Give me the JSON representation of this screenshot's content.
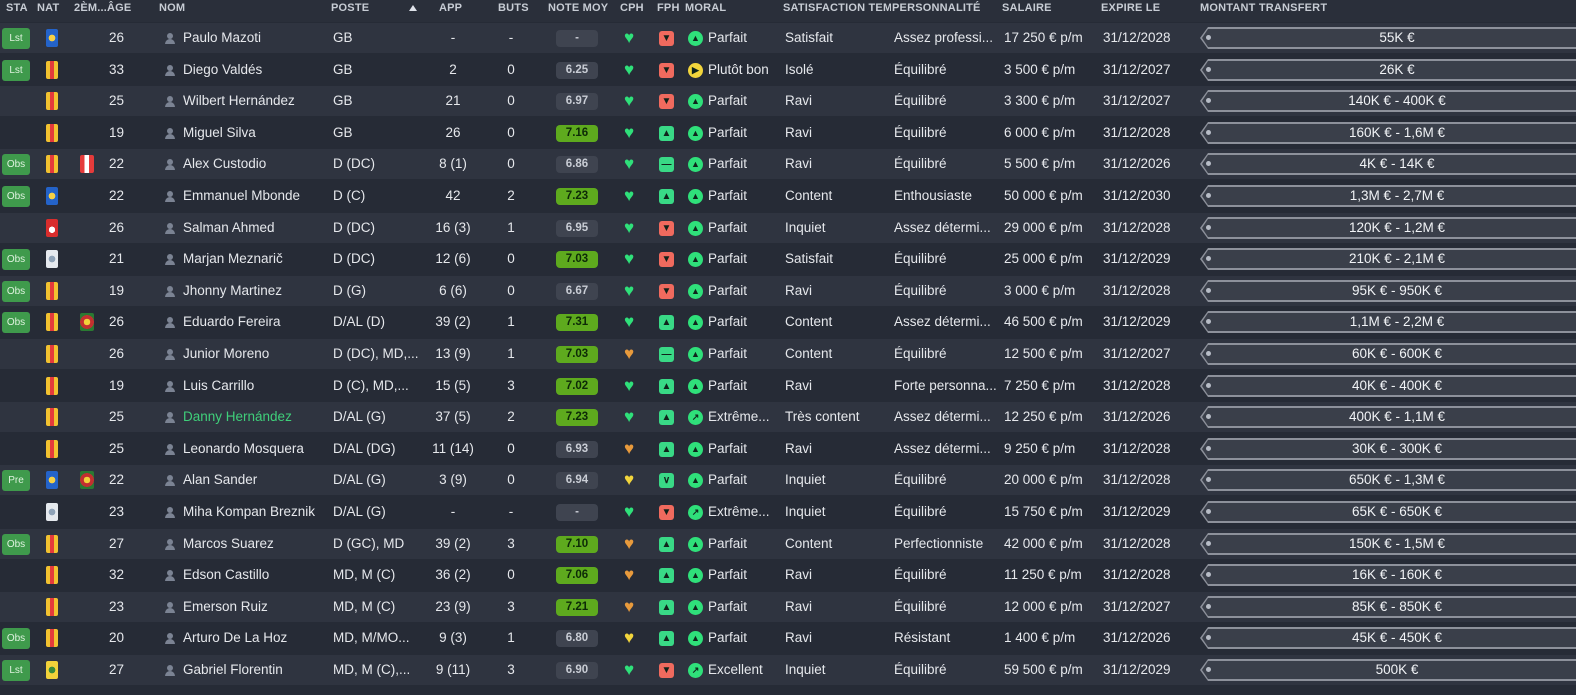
{
  "headers": {
    "sta": "STA",
    "nat": "NAT",
    "nat2": "2ÈM...",
    "age": "ÂGE",
    "nom": "NOM",
    "poste": "POSTE",
    "app": "APP",
    "buts": "BUTS",
    "note": "NOTE MOY",
    "cph": "CPH",
    "fph": "FPH",
    "moral": "MORAL",
    "satisfaction": "SATISFACTION TEM...",
    "personnalite": "PERSONNALITÉ",
    "salaire": "SALAIRE",
    "expire": "EXPIRE LE",
    "transfert": "MONTANT TRANSFERT"
  },
  "colors": {
    "header_bg": "#2a2f3a",
    "row_odd": "#2f3440",
    "row_even": "#262b36",
    "badge_green": "#3f9a4c",
    "note_green": "#5eaa1e",
    "heart_green": "#2fe07a",
    "heart_orange": "#e89a3c",
    "fph_green": "#39d986",
    "fph_red": "#f06a5e",
    "fph_yellow": "#f2d53c",
    "highlight_name": "#3fcf7a"
  },
  "players": [
    {
      "sta": "Lst",
      "nat": "blue",
      "nat2": "",
      "age": "26",
      "nom": "Paulo Mazoti",
      "poste": "GB",
      "app": "-",
      "buts": "-",
      "note": "-",
      "note_level": "grey",
      "cph": "green",
      "fph": "red",
      "moral": "Parfait",
      "moral_icon": "up",
      "satisfaction": "Satisfait",
      "personnalite": "Assez professi...",
      "salaire": "17 250 € p/m",
      "expire": "31/12/2028",
      "transfert": "55K €"
    },
    {
      "sta": "Lst",
      "nat": "col",
      "nat2": "",
      "age": "33",
      "nom": "Diego Valdés",
      "poste": "GB",
      "app": "2",
      "buts": "0",
      "note": "6.25",
      "note_level": "grey",
      "cph": "green",
      "fph": "red",
      "moral": "Plutôt bon",
      "moral_icon": "right-yellow",
      "satisfaction": "Isolé",
      "personnalite": "Équilibré",
      "salaire": "3 500 € p/m",
      "expire": "31/12/2027",
      "transfert": "26K €"
    },
    {
      "sta": "",
      "nat": "col",
      "nat2": "",
      "age": "25",
      "nom": "Wilbert Hernández",
      "poste": "GB",
      "app": "21",
      "buts": "0",
      "note": "6.97",
      "note_level": "grey",
      "cph": "green",
      "fph": "red",
      "moral": "Parfait",
      "moral_icon": "up",
      "satisfaction": "Ravi",
      "personnalite": "Équilibré",
      "salaire": "3 300 € p/m",
      "expire": "31/12/2027",
      "transfert": "140K € - 400K €"
    },
    {
      "sta": "",
      "nat": "col",
      "nat2": "",
      "age": "19",
      "nom": "Miguel Silva",
      "poste": "GB",
      "app": "26",
      "buts": "0",
      "note": "7.16",
      "note_level": "green",
      "cph": "green",
      "fph": "green",
      "moral": "Parfait",
      "moral_icon": "up",
      "satisfaction": "Ravi",
      "personnalite": "Équilibré",
      "salaire": "6 000 € p/m",
      "expire": "31/12/2028",
      "transfert": "160K € - 1,6M €"
    },
    {
      "sta": "Obs",
      "nat": "col",
      "nat2": "per",
      "age": "22",
      "nom": "Alex Custodio",
      "poste": "D (DC)",
      "app": "8 (1)",
      "buts": "0",
      "note": "6.86",
      "note_level": "grey",
      "cph": "green",
      "fph": "green-dash",
      "moral": "Parfait",
      "moral_icon": "up",
      "satisfaction": "Ravi",
      "personnalite": "Équilibré",
      "salaire": "5 500 € p/m",
      "expire": "31/12/2026",
      "transfert": "4K € - 14K €"
    },
    {
      "sta": "Obs",
      "nat": "blue",
      "nat2": "",
      "age": "22",
      "nom": "Emmanuel Mbonde",
      "poste": "D (C)",
      "app": "42",
      "buts": "2",
      "note": "7.23",
      "note_level": "green",
      "cph": "green",
      "fph": "green",
      "moral": "Parfait",
      "moral_icon": "up",
      "satisfaction": "Content",
      "personnalite": "Enthousiaste",
      "salaire": "50 000 € p/m",
      "expire": "31/12/2030",
      "transfert": "1,3M € - 2,7M €"
    },
    {
      "sta": "",
      "nat": "red",
      "nat2": "",
      "age": "26",
      "nom": "Salman Ahmed",
      "poste": "D (DC)",
      "app": "16 (3)",
      "buts": "1",
      "note": "6.95",
      "note_level": "grey",
      "cph": "green",
      "fph": "red",
      "moral": "Parfait",
      "moral_icon": "up",
      "satisfaction": "Inquiet",
      "personnalite": "Assez détermi...",
      "salaire": "29 000 € p/m",
      "expire": "31/12/2028",
      "transfert": "120K € - 1,2M €"
    },
    {
      "sta": "Obs",
      "nat": "white",
      "nat2": "",
      "age": "21",
      "nom": "Marjan Meznarič",
      "poste": "D (DC)",
      "app": "12 (6)",
      "buts": "0",
      "note": "7.03",
      "note_level": "green",
      "cph": "green",
      "fph": "red",
      "moral": "Parfait",
      "moral_icon": "up",
      "satisfaction": "Satisfait",
      "personnalite": "Équilibré",
      "salaire": "25 000 € p/m",
      "expire": "31/12/2029",
      "transfert": "210K € - 2,1M €"
    },
    {
      "sta": "Obs",
      "nat": "col",
      "nat2": "",
      "age": "19",
      "nom": "Jhonny Martinez",
      "poste": "D (G)",
      "app": "6 (6)",
      "buts": "0",
      "note": "6.67",
      "note_level": "grey",
      "cph": "green",
      "fph": "red",
      "moral": "Parfait",
      "moral_icon": "up",
      "satisfaction": "Ravi",
      "personnalite": "Équilibré",
      "salaire": "3 000 € p/m",
      "expire": "31/12/2028",
      "transfert": "95K € - 950K €"
    },
    {
      "sta": "Obs",
      "nat": "col",
      "nat2": "por",
      "age": "26",
      "nom": "Eduardo Fereira",
      "poste": "D/AL (D)",
      "app": "39 (2)",
      "buts": "1",
      "note": "7.31",
      "note_level": "green",
      "cph": "green",
      "fph": "green",
      "moral": "Parfait",
      "moral_icon": "up",
      "satisfaction": "Content",
      "personnalite": "Assez détermi...",
      "salaire": "46 500 € p/m",
      "expire": "31/12/2029",
      "transfert": "1,1M € - 2,2M €"
    },
    {
      "sta": "",
      "nat": "col",
      "nat2": "",
      "age": "26",
      "nom": "Junior Moreno",
      "poste": "D (DC), MD,...",
      "app": "13 (9)",
      "buts": "1",
      "note": "7.03",
      "note_level": "green",
      "cph": "orange",
      "fph": "green-dash",
      "moral": "Parfait",
      "moral_icon": "up",
      "satisfaction": "Content",
      "personnalite": "Équilibré",
      "salaire": "12 500 € p/m",
      "expire": "31/12/2027",
      "transfert": "60K € - 600K €"
    },
    {
      "sta": "",
      "nat": "col",
      "nat2": "",
      "age": "19",
      "nom": "Luis Carrillo",
      "poste": "D (C), MD,...",
      "app": "15 (5)",
      "buts": "3",
      "note": "7.02",
      "note_level": "green",
      "cph": "green",
      "fph": "green",
      "moral": "Parfait",
      "moral_icon": "up",
      "satisfaction": "Ravi",
      "personnalite": "Forte personna...",
      "salaire": "7 250 € p/m",
      "expire": "31/12/2028",
      "transfert": "40K € - 400K €"
    },
    {
      "sta": "",
      "nat": "col",
      "nat2": "",
      "age": "25",
      "nom": "Danny Hernández",
      "poste": "D/AL (G)",
      "app": "37 (5)",
      "buts": "2",
      "note": "7.23",
      "note_level": "green",
      "cph": "green",
      "fph": "green",
      "moral": "Extrême...",
      "moral_icon": "upright",
      "satisfaction": "Très content",
      "personnalite": "Assez détermi...",
      "salaire": "12 250 € p/m",
      "expire": "31/12/2026",
      "transfert": "400K € - 1,1M €",
      "highlight": true
    },
    {
      "sta": "",
      "nat": "col",
      "nat2": "",
      "age": "25",
      "nom": "Leonardo Mosquera",
      "poste": "D/AL (DG)",
      "app": "11 (14)",
      "buts": "0",
      "note": "6.93",
      "note_level": "grey",
      "cph": "orange",
      "fph": "green",
      "moral": "Parfait",
      "moral_icon": "up",
      "satisfaction": "Ravi",
      "personnalite": "Assez détermi...",
      "salaire": "9 250 € p/m",
      "expire": "31/12/2028",
      "transfert": "30K € - 300K €"
    },
    {
      "sta": "Pre",
      "nat": "blue",
      "nat2": "por",
      "age": "22",
      "nom": "Alan Sander",
      "poste": "D/AL (G)",
      "app": "3 (9)",
      "buts": "0",
      "note": "6.94",
      "note_level": "grey",
      "cph": "yellow",
      "fph": "green-down",
      "moral": "Parfait",
      "moral_icon": "up",
      "satisfaction": "Inquiet",
      "personnalite": "Équilibré",
      "salaire": "20 000 € p/m",
      "expire": "31/12/2028",
      "transfert": "650K € - 1,3M €"
    },
    {
      "sta": "",
      "nat": "white",
      "nat2": "",
      "age": "23",
      "nom": "Miha Kompan Breznik",
      "poste": "D/AL (G)",
      "app": "-",
      "buts": "-",
      "note": "-",
      "note_level": "grey",
      "cph": "green",
      "fph": "red",
      "moral": "Extrême...",
      "moral_icon": "upright",
      "satisfaction": "Inquiet",
      "personnalite": "Équilibré",
      "salaire": "15 750 € p/m",
      "expire": "31/12/2029",
      "transfert": "65K € - 650K €"
    },
    {
      "sta": "Obs",
      "nat": "col",
      "nat2": "",
      "age": "27",
      "nom": "Marcos Suarez",
      "poste": "D (GC), MD",
      "app": "39 (2)",
      "buts": "3",
      "note": "7.10",
      "note_level": "green",
      "cph": "orange",
      "fph": "green",
      "moral": "Parfait",
      "moral_icon": "up",
      "satisfaction": "Content",
      "personnalite": "Perfectionniste",
      "salaire": "42 000 € p/m",
      "expire": "31/12/2028",
      "transfert": "150K € - 1,5M €"
    },
    {
      "sta": "",
      "nat": "col",
      "nat2": "",
      "age": "32",
      "nom": "Edson Castillo",
      "poste": "MD, M (C)",
      "app": "36 (2)",
      "buts": "0",
      "note": "7.06",
      "note_level": "green",
      "cph": "orange",
      "fph": "green",
      "moral": "Parfait",
      "moral_icon": "up",
      "satisfaction": "Ravi",
      "personnalite": "Équilibré",
      "salaire": "11 250 € p/m",
      "expire": "31/12/2028",
      "transfert": "16K € - 160K €"
    },
    {
      "sta": "",
      "nat": "col",
      "nat2": "",
      "age": "23",
      "nom": "Emerson Ruiz",
      "poste": "MD, M (C)",
      "app": "23 (9)",
      "buts": "3",
      "note": "7.21",
      "note_level": "green",
      "cph": "orange",
      "fph": "green",
      "moral": "Parfait",
      "moral_icon": "up",
      "satisfaction": "Ravi",
      "personnalite": "Équilibré",
      "salaire": "12 000 € p/m",
      "expire": "31/12/2027",
      "transfert": "85K € - 850K €"
    },
    {
      "sta": "Obs",
      "nat": "col",
      "nat2": "",
      "age": "20",
      "nom": "Arturo De La Hoz",
      "poste": "MD, M/MO...",
      "app": "9 (3)",
      "buts": "1",
      "note": "6.80",
      "note_level": "grey",
      "cph": "yellow",
      "fph": "green",
      "moral": "Parfait",
      "moral_icon": "up",
      "satisfaction": "Ravi",
      "personnalite": "Résistant",
      "salaire": "1 400 € p/m",
      "expire": "31/12/2026",
      "transfert": "45K € - 450K €"
    },
    {
      "sta": "Lst",
      "nat": "gold",
      "nat2": "",
      "age": "27",
      "nom": "Gabriel Florentin",
      "poste": "MD, M (C),...",
      "app": "9 (11)",
      "buts": "3",
      "note": "6.90",
      "note_level": "grey",
      "cph": "green",
      "fph": "red",
      "moral": "Excellent",
      "moral_icon": "upright",
      "satisfaction": "Inquiet",
      "personnalite": "Équilibré",
      "salaire": "59 500 € p/m",
      "expire": "31/12/2029",
      "transfert": "500K €"
    }
  ]
}
